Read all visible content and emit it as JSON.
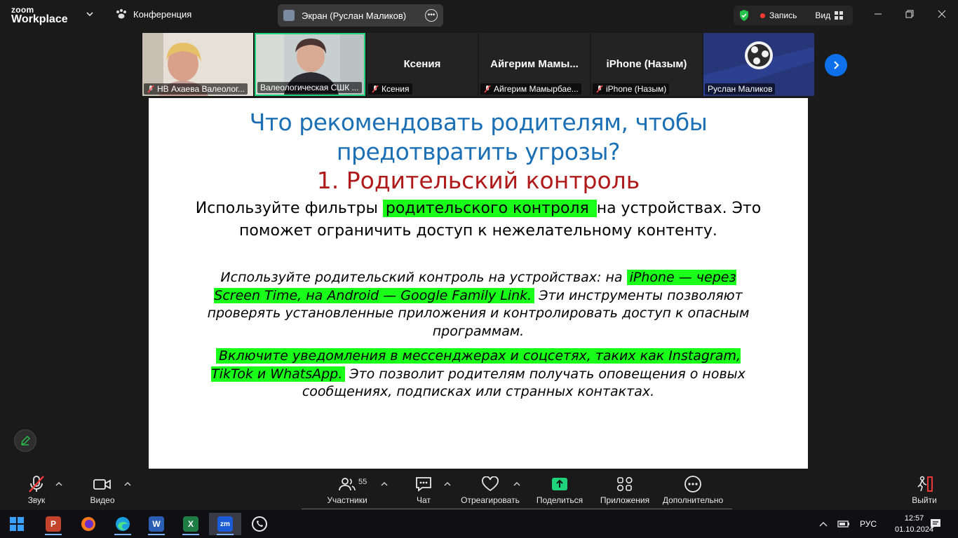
{
  "app": {
    "logo_line1": "zoom",
    "logo_line2": "Workplace",
    "conference_label": "Конференция"
  },
  "share": {
    "screen_owner_label": "Экран (Руслан Маликов)",
    "record_label": "Запись",
    "view_label": "Вид"
  },
  "participants": [
    {
      "name": "НВ Ахаева Валеолог...",
      "big": "",
      "muted": true,
      "video": true
    },
    {
      "name": "Валеологическая СШК ...",
      "big": "",
      "muted": false,
      "video": true,
      "active": true
    },
    {
      "name": "Ксения",
      "big": "Ксения",
      "muted": true,
      "video": false
    },
    {
      "name": "Айгерим Мамырбае...",
      "big": "Айгерим  Мамы...",
      "muted": true,
      "video": false
    },
    {
      "name": "iPhone (Назым)",
      "big": "iPhone (Назым)",
      "muted": true,
      "video": false
    },
    {
      "name": "Руслан Маликов",
      "big": "",
      "muted": false,
      "video": false,
      "obs": true
    }
  ],
  "slide": {
    "title": "Что рекомендовать родителям, чтобы предотвратить угрозы?",
    "subtitle": "1. Родительский контроль",
    "p1_a": "Используйте фильтры ",
    "p1_hl": "родительского контроля ",
    "p1_b": "на устройствах. Это поможет ограничить доступ к нежелательному контенту.",
    "p2_a": "Используйте родительский контроль на устройствах: на ",
    "p2_hl": "iPhone — через Screen Time, на Android — Google Family Link.",
    "p2_b": " Эти инструменты позволяют проверять установленные приложения и контролировать доступ к опасным программам.",
    "p3_hl": "Включите уведомления в мессенджерах и соцсетях, таких как Instagram, TikTok и WhatsApp.",
    "p3_b": " Это позволит родителям получать оповещения о новых сообщениях, подписках или странных контактах."
  },
  "toolbar": {
    "audio": "Звук",
    "video": "Видео",
    "participants": "Участники",
    "participants_count": "55",
    "chat": "Чат",
    "react": "Отреагировать",
    "share": "Поделиться",
    "apps": "Приложения",
    "more": "Дополнительно",
    "leave": "Выйти"
  },
  "taskbar": {
    "lang": "РУС",
    "time": "12:57",
    "date": "01.10.2024"
  },
  "colors": {
    "accent": "#0e71eb",
    "share_green": "#1fd37a",
    "slide_title": "#1a6fb5",
    "slide_subtitle": "#b01a1a",
    "highlight": "#1aff1a"
  }
}
